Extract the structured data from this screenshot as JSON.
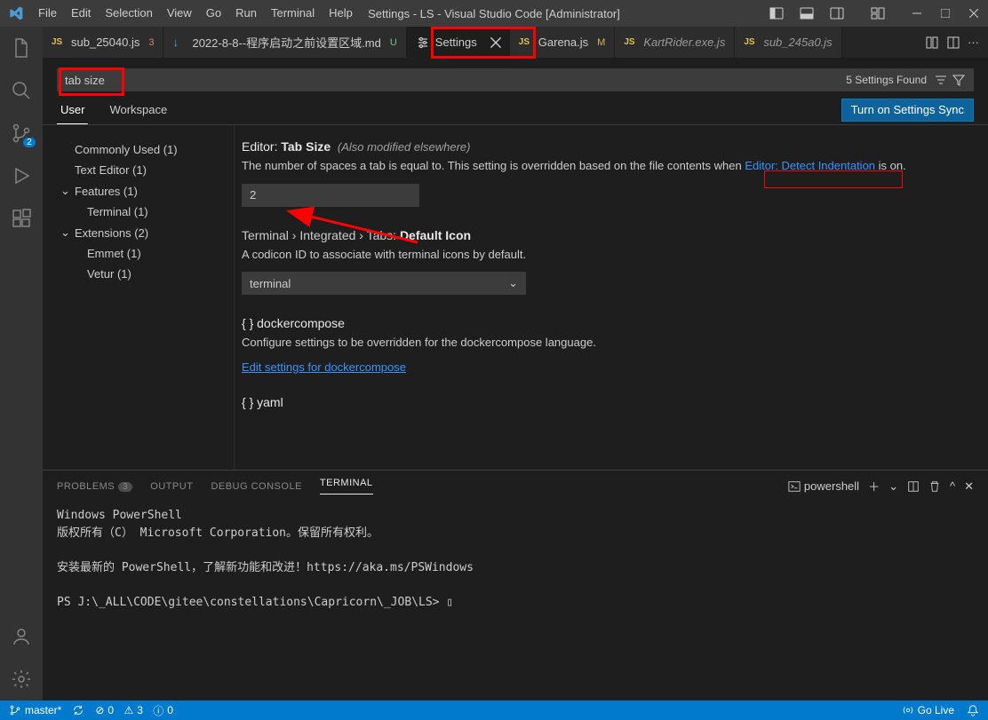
{
  "title": "Settings - LS - Visual Studio Code [Administrator]",
  "menu": [
    "File",
    "Edit",
    "Selection",
    "View",
    "Go",
    "Run",
    "Terminal",
    "Help"
  ],
  "tabs": [
    {
      "icon": "js",
      "label": "sub_25040.js",
      "dirty": "3",
      "dirtyClass": "num"
    },
    {
      "icon": "md",
      "label": "2022-8-8--程序启动之前设置区域.md",
      "dirty": "U",
      "dirtyClass": "green"
    },
    {
      "icon": "settings",
      "label": "Settings",
      "close": true,
      "active": true
    },
    {
      "icon": "js",
      "label": "Garena.js",
      "dirty": "M",
      "dirtyClass": ""
    },
    {
      "icon": "js",
      "label": "KartRider.exe.js",
      "italic": true
    },
    {
      "icon": "js",
      "label": "sub_245a0.js",
      "italic": true
    }
  ],
  "search": {
    "value": "tab size",
    "count": "5 Settings Found"
  },
  "scopes": {
    "user": "User",
    "workspace": "Workspace",
    "sync": "Turn on Settings Sync"
  },
  "sidebar": {
    "common": "Commonly Used (1)",
    "texteditor": "Text Editor (1)",
    "features": "Features (1)",
    "terminal": "Terminal (1)",
    "extensions": "Extensions (2)",
    "emmet": "Emmet (1)",
    "vetur": "Vetur (1)"
  },
  "settings": {
    "tabsize": {
      "title_pre": "Editor: ",
      "title": "Tab Size",
      "also": "(Also modified elsewhere)",
      "desc_pre": "The number of spaces a tab is equal to. This setting is overridden based on the file contents when ",
      "desc_link": "Editor: Detect Indentation",
      "desc_post": " is on.",
      "value": "2"
    },
    "termicon": {
      "title": "Terminal › Integrated › Tabs: Default Icon",
      "desc": "A codicon ID to associate with terminal icons by default.",
      "value": "terminal"
    },
    "docker": {
      "title": "{ } dockercompose",
      "desc": "Configure settings to be overridden for the dockercompose language.",
      "link": "Edit settings for dockercompose"
    },
    "yaml": {
      "title": "{ } yaml"
    }
  },
  "panel": {
    "tabs": {
      "problems": "PROBLEMS",
      "problems_n": "3",
      "output": "OUTPUT",
      "debug": "DEBUG CONSOLE",
      "terminal": "TERMINAL"
    },
    "shell": "powershell",
    "out": "Windows PowerShell\n版权所有（C） Microsoft Corporation。保留所有权利。\n\n安装最新的 PowerShell，了解新功能和改进！https://aka.ms/PSWindows\n\nPS J:\\_ALL\\CODE\\gitee\\constellations\\Capricorn\\_JOB\\LS> ▯"
  },
  "status": {
    "branch": "master*",
    "sync": "",
    "errors": "0",
    "warnings": "3",
    "info": "0",
    "golive": "Go Live"
  }
}
